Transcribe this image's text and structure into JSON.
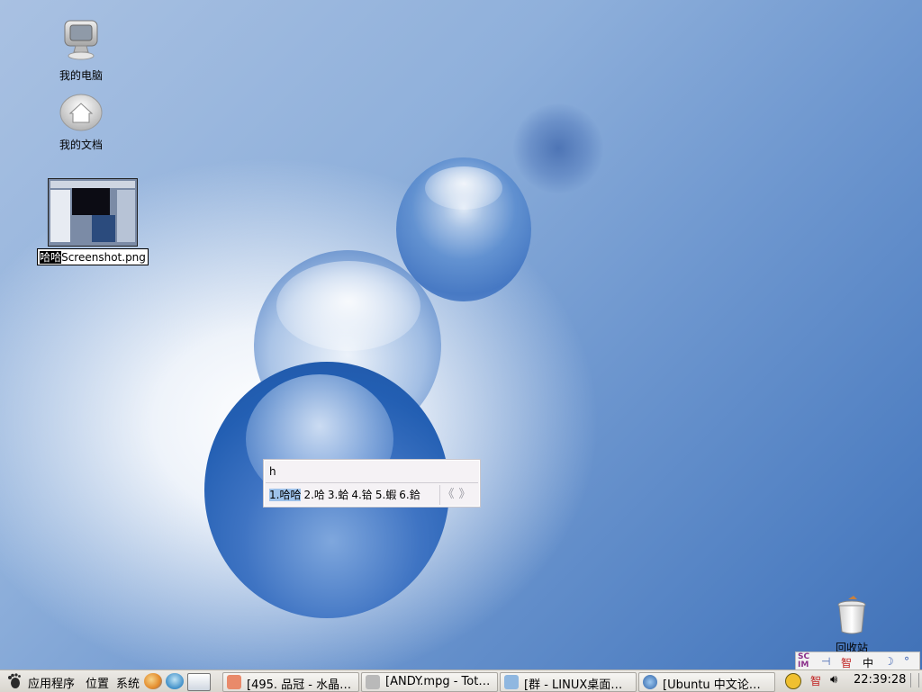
{
  "desktop": {
    "icons": [
      {
        "label": "我的电脑"
      },
      {
        "label": "我的文档"
      },
      {
        "label_selected": "哈哈",
        "label_rest": "Screenshot.png"
      },
      {
        "label": "回收站"
      }
    ]
  },
  "ime": {
    "preedit": "h",
    "candidates": [
      "1.哈哈",
      "2.哈",
      "3.蛤",
      "4.铪",
      "5.蝦",
      "6.鉿"
    ],
    "nav_prev": "《",
    "nav_next": "》"
  },
  "scim": {
    "logo": "SCIM",
    "items": [
      "⊣",
      "智",
      "中",
      "☽",
      "°"
    ]
  },
  "taskbar": {
    "menus": [
      "应用程序",
      "位置",
      "系统"
    ],
    "tasks": [
      {
        "label": "[495. 品冠 - 水晶…"
      },
      {
        "label": "[ANDY.mpg - Tot…"
      },
      {
        "label": "[群 - LINUX桌面…"
      },
      {
        "label": "[Ubuntu 中文论…"
      }
    ],
    "tray": [
      "智"
    ],
    "clock": "22:39:28"
  },
  "colors": {
    "taskbar_bg": "#dcd9d2",
    "candidate_highlight": "#9ec2ea",
    "desktop_blue": "#4f7fc2"
  }
}
